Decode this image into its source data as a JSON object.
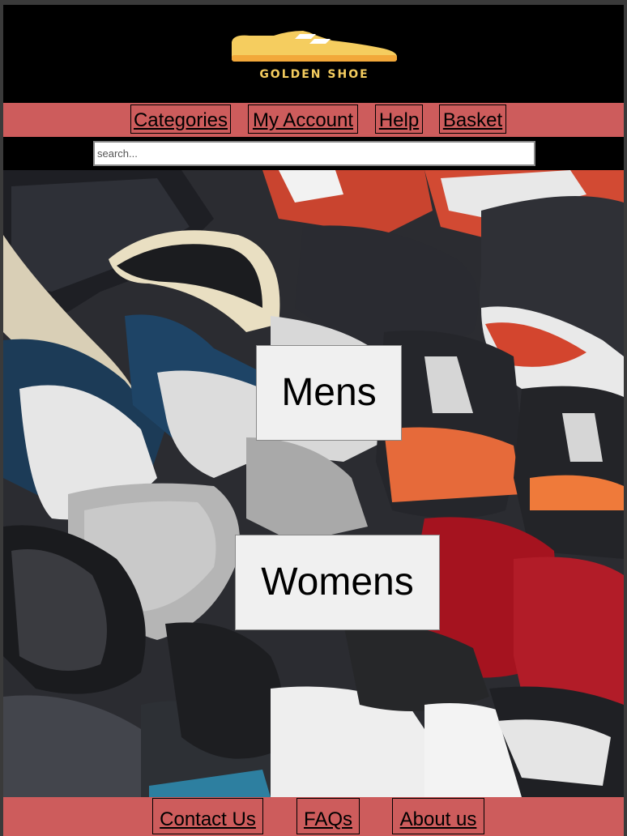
{
  "brand": {
    "name": "GOLDEN SHOE",
    "logo_icon": "shoe-icon",
    "accent": "#f5cd5f"
  },
  "nav": {
    "items": [
      {
        "label": "Categories"
      },
      {
        "label": "My Account"
      },
      {
        "label": "Help"
      },
      {
        "label": "Basket"
      }
    ],
    "background": "#cd5c5c"
  },
  "search": {
    "placeholder": "search...",
    "value": ""
  },
  "hero": {
    "buttons": [
      {
        "label": "Mens"
      },
      {
        "label": "Womens"
      }
    ]
  },
  "footer": {
    "items": [
      {
        "label": "Contact Us"
      },
      {
        "label": "FAQs"
      },
      {
        "label": "About us"
      }
    ]
  }
}
